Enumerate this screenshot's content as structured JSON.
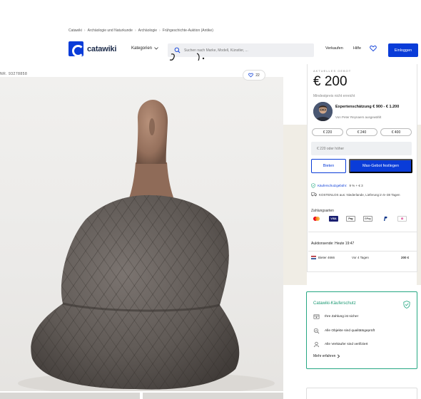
{
  "breadcrumb": [
    "Catawiki",
    "Archäologie und Naturkunde",
    "Archäologie",
    "Frühgeschichte-Auktion (Antike)"
  ],
  "header": {
    "logo_text": "catawiki",
    "categories": "Kategorien",
    "search_placeholder": "Suchen nach Marke, Modell, Künstler, ...",
    "sell": "Verkaufen",
    "help": "Hilfe",
    "login": "Einloggen"
  },
  "lot": {
    "number": "NR. 93278858",
    "favorites": "22"
  },
  "bidding": {
    "current_label": "AKTUELLES GEBOT",
    "current_price": "€ 200",
    "reserve": "Mindestpreis nicht erreicht",
    "expert_estimate": "Expertenschätzung € 900 - € 1.200",
    "expert_by": "Von Peter Reynaers ausgewählt",
    "quick_bids": [
      "€ 220",
      "€ 240",
      "€ 400"
    ],
    "bid_input_placeholder": "€  220 oder höher",
    "bid_button": "Bieten",
    "max_bid_button": "Max-Gebot festlegen",
    "protection_fee_link": "Käuferschutzgebühr:",
    "protection_fee_value": "9 % + € 3",
    "shipping": "KOSTENLOS aus: Niederlande, Lieferung in 5–38 Tagen",
    "payment_label": "Zahlungsarten",
    "payment_methods": [
      "Mastercard",
      "VISA",
      "Apple Pay",
      "G Pay",
      "PayPal",
      "iDEAL"
    ],
    "auction_end": "Auktionsende: Heute 19:47",
    "last_bid": {
      "bidder": "Bieter 4666",
      "when": "Vor 4 Tagen",
      "amount": "200 €"
    }
  },
  "buyer_protection": {
    "title": "Catawiki-Käuferschutz",
    "items": [
      {
        "icon": "payment-safe-icon",
        "text": "Ihre Zahlung ist sicher"
      },
      {
        "icon": "quality-check-icon",
        "text": "Alle Objekte sind qualitätsgeprüft"
      },
      {
        "icon": "verified-seller-icon",
        "text": "Alle Verkäufer sind verifiziert"
      }
    ],
    "learn_more": "Mehr erfahren"
  },
  "colors": {
    "brand_blue": "#0a3cd8",
    "protection_green": "#26a883",
    "beige": "#f0ede5"
  }
}
